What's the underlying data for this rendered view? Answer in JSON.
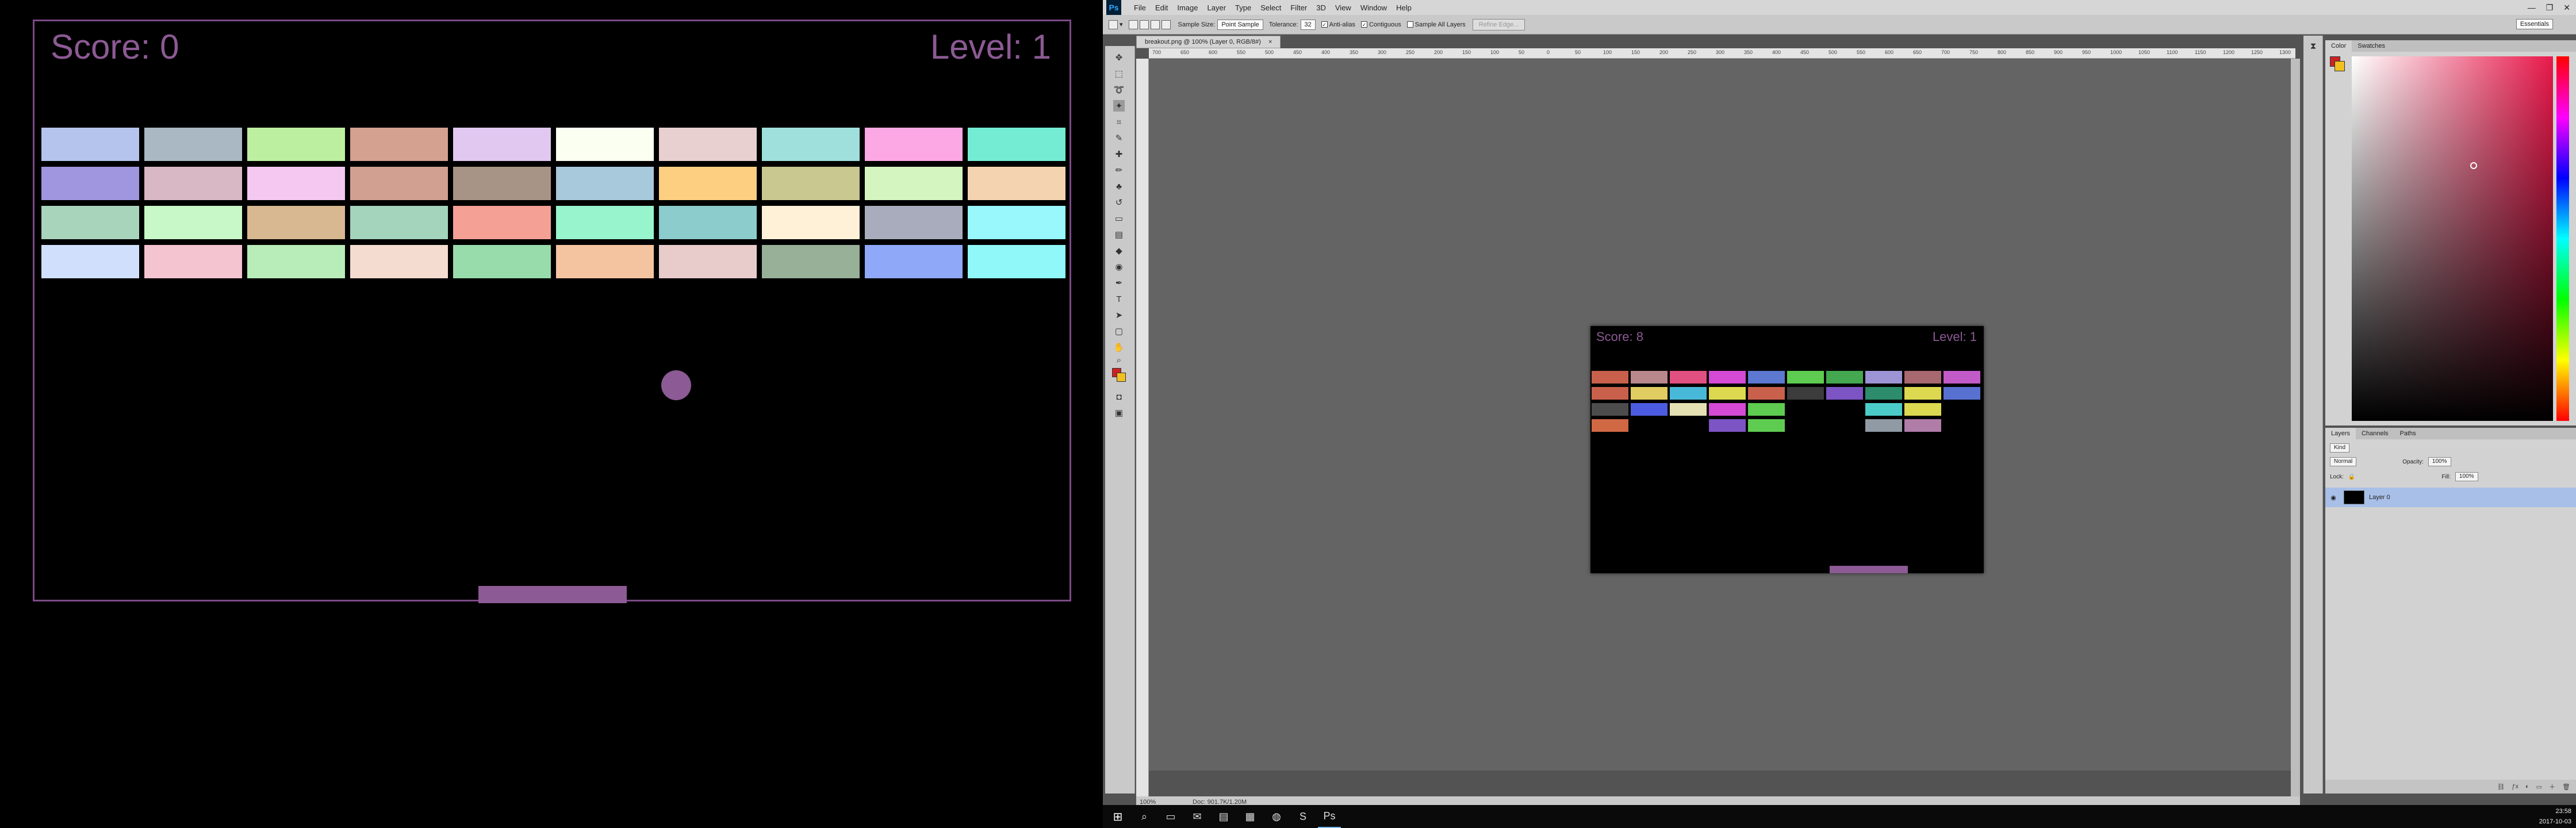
{
  "game": {
    "score": "Score: 0",
    "level": "Level: 1",
    "text_color": "#8c5a94",
    "border_color": "#7b4a86",
    "ball_color": "#8c5a94",
    "paddle_color": "#8c5a94",
    "brick_rows": [
      [
        "#b4c4ec",
        "#a9b8c2",
        "#bcf0a0",
        "#d4a090",
        "#e0c8f0",
        "#fafff2",
        "#e8d0d0",
        "#a0e0dc",
        "#fca8e4",
        "#74ecd4"
      ],
      [
        "#a096e0",
        "#d8b8c4",
        "#f4c8f0",
        "#d2a090",
        "#a89486",
        "#a8c8dc",
        "#fcd080",
        "#c8c890",
        "#d4f4c0",
        "#f4d4b0"
      ],
      [
        "#a8d4bc",
        "#c8f8c8",
        "#d8b890",
        "#a4d4bc",
        "#f4a094",
        "#98f4cc",
        "#8ccccc",
        "#fff0d8",
        "#a8acbc",
        "#98f8fc"
      ],
      [
        "#d0e0fc",
        "#f4c4d0",
        "#b8ecb8",
        "#f4dcd0",
        "#98dcac",
        "#f4c4a0",
        "#e8cccc",
        "#98b098",
        "#90a8f8",
        "#90f8f8"
      ]
    ]
  },
  "photoshop": {
    "logo": "Ps",
    "menu": [
      "File",
      "Edit",
      "Image",
      "Layer",
      "Type",
      "Select",
      "Filter",
      "3D",
      "View",
      "Window",
      "Help"
    ],
    "window_controls": [
      "—",
      "❐",
      "✕"
    ],
    "options": {
      "sample_size_label": "Sample Size:",
      "sample_size_value": "Point Sample",
      "tolerance_label": "Tolerance:",
      "tolerance_value": "32",
      "anti_alias": "Anti-alias",
      "contiguous": "Contiguous",
      "sample_all_layers": "Sample All Layers",
      "refine_edge": "Refine Edge...",
      "workspace": "Essentials"
    },
    "document_tab": "breakout.png @ 100% (Layer 0, RGB/8#)",
    "document_tab_close": "×",
    "ruler_ticks": [
      "700",
      "650",
      "600",
      "550",
      "500",
      "450",
      "400",
      "350",
      "300",
      "250",
      "200",
      "150",
      "100",
      "50",
      "0",
      "50",
      "100",
      "150",
      "200",
      "250",
      "300",
      "350",
      "400",
      "450",
      "500",
      "550",
      "600",
      "650",
      "700",
      "750",
      "800",
      "850",
      "900",
      "950",
      "1000",
      "1050",
      "1100",
      "1150",
      "1200",
      "1250",
      "1300"
    ],
    "status_zoom": "100%",
    "status_doc": "Doc: 901.7K/1.20M",
    "screenshot": {
      "score": "Score: 8",
      "level": "Level: 1",
      "bricks": [
        [
          "#c8604c",
          "#b8888c",
          "#e05080",
          "#d44ad4",
          "#5c78d0",
          "#5ecc50",
          "#44a850",
          "#9c94d4",
          "#a86870",
          "#c25ac8"
        ],
        [
          "#c8604c",
          "#e0cc60",
          "#48b8d8",
          "#dcd850",
          "#c8604c",
          "#3c3c3c",
          "#7c54c4",
          "#2c8c6c",
          "#dcd850",
          "#5870d0"
        ],
        [
          "#4c4c4c",
          "#4c5ce0",
          "#e4e0b4",
          "#d44ad4",
          "#5ecc50",
          null,
          null,
          "#4cccc8",
          "#dcd850",
          null
        ],
        [
          "#d06844",
          null,
          null,
          "#7c54c4",
          "#5ecc50",
          null,
          null,
          "#909aa4",
          "#b07ca8",
          null
        ]
      ]
    },
    "panels": {
      "color_tabs": [
        "Color",
        "Swatches"
      ],
      "layers_tabs": [
        "Layers",
        "Channels",
        "Paths"
      ],
      "kind_label": "Kind",
      "blend_mode": "Normal",
      "opacity_label": "Opacity:",
      "opacity_value": "100%",
      "lock_label": "Lock:",
      "fill_label": "Fill:",
      "fill_value": "100%",
      "layer_name": "Layer 0"
    }
  },
  "taskbar": {
    "time": "23:58",
    "date": "2017-10-03"
  }
}
